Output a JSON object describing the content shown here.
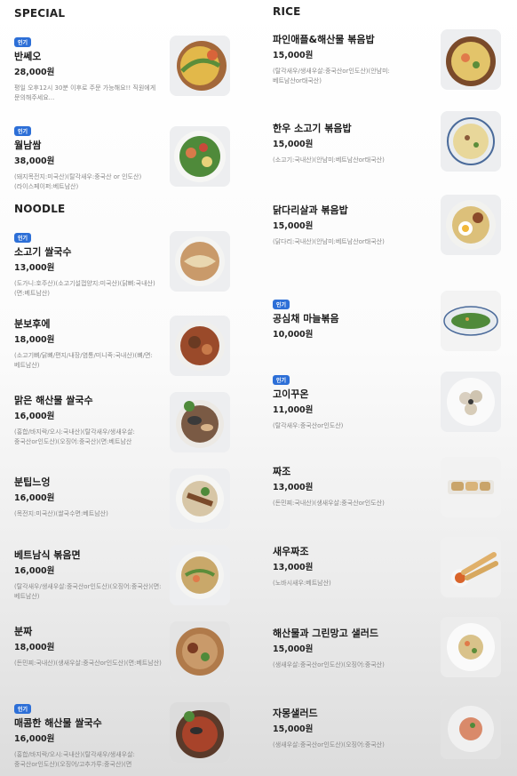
{
  "sections": {
    "special": "SPECIAL",
    "noodle": "NOODLE",
    "rice": "RICE"
  },
  "badge_label": "인기",
  "special": [
    {
      "name": "반쎄오",
      "price": "28,000원",
      "desc": "평일 오후12시 30분 이후로 주문 가능해요!! 직원에게 문의해주세요..."
    },
    {
      "name": "월남쌈",
      "price": "38,000원",
      "desc": "(돼지목전지:미국산)(탈각새우:중국산 or 인도산)(라이스페이퍼:베트남산)"
    }
  ],
  "noodle": [
    {
      "name": "소고기 쌀국수",
      "price": "13,000원",
      "desc": "(도가니:호주산)(소고기설껍양지:미국산)(닭뼈:국내산)(면:베트남산)"
    },
    {
      "name": "분보후에",
      "price": "18,000원",
      "desc": "(소고기뼈/닭뼈/편지/내장/염통/미니족:국내산)(뼈/면:베트남산)"
    },
    {
      "name": "맑은 해산물 쌀국수",
      "price": "16,000원",
      "desc": "(홍합/바지락/오시:국내산)(탈각새우/생새우살:중국산or인도산)(오징어:중국산)(면:베트남산"
    },
    {
      "name": "분팁느엉",
      "price": "16,000원",
      "desc": "(목전지:미국산)(쌀국수면:베트남산)"
    },
    {
      "name": "베트남식 볶음면",
      "price": "16,000원",
      "desc": "(탈각새우/생새우살:중국산or인도산)(오징어:중국산)(면:베트남산)"
    },
    {
      "name": "분짜",
      "price": "18,000원",
      "desc": "(돈민찌:국내산)(생새우살:중국산or인도산)(면:베트남산)"
    },
    {
      "name": "매콤한 해산물 쌀국수",
      "price": "16,000원",
      "desc": "(홍합/바지락/오시:국내산)(탈각새우/생새우살:중국산or인도산)(오징어/고추가루:중국산)(면"
    }
  ],
  "rice": [
    {
      "name": "파인애플&해산물 볶음밥",
      "price": "15,000원",
      "desc": "(탈각새우/생새우살:중국산or인도산)(안남미:베트남산or태국산)"
    },
    {
      "name": "한우 소고기 볶음밥",
      "price": "15,000원",
      "desc": "(소고기:국내산)(안남미:베트남산or태국산)"
    },
    {
      "name": "닭다리살과 볶음밥",
      "price": "15,000원",
      "desc": "(닭다리:국내산)(안남미:베트남산or태국산)"
    },
    {
      "name": "공심채 마늘볶음",
      "price": "10,000원",
      "desc": ""
    },
    {
      "name": "고이꾸온",
      "price": "11,000원",
      "desc": "(탈각새우:중국산or인도산)"
    },
    {
      "name": "짜조",
      "price": "13,000원",
      "desc": "(돈민찌:국내산)(생새우살:중국산or인도산)"
    },
    {
      "name": "새우짜조",
      "price": "13,000원",
      "desc": "(노바시새우:베트남산)"
    },
    {
      "name": "해산물과 그린망고 샐러드",
      "price": "15,000원",
      "desc": "(생새우살:중국산or인도산)(오징어:중국산)"
    },
    {
      "name": "자몽샐러드",
      "price": "15,000원",
      "desc": "(생새우살:중국산or인도산)(오징어:중국산)"
    }
  ],
  "colors": {
    "badge": "#2d6fd7"
  }
}
